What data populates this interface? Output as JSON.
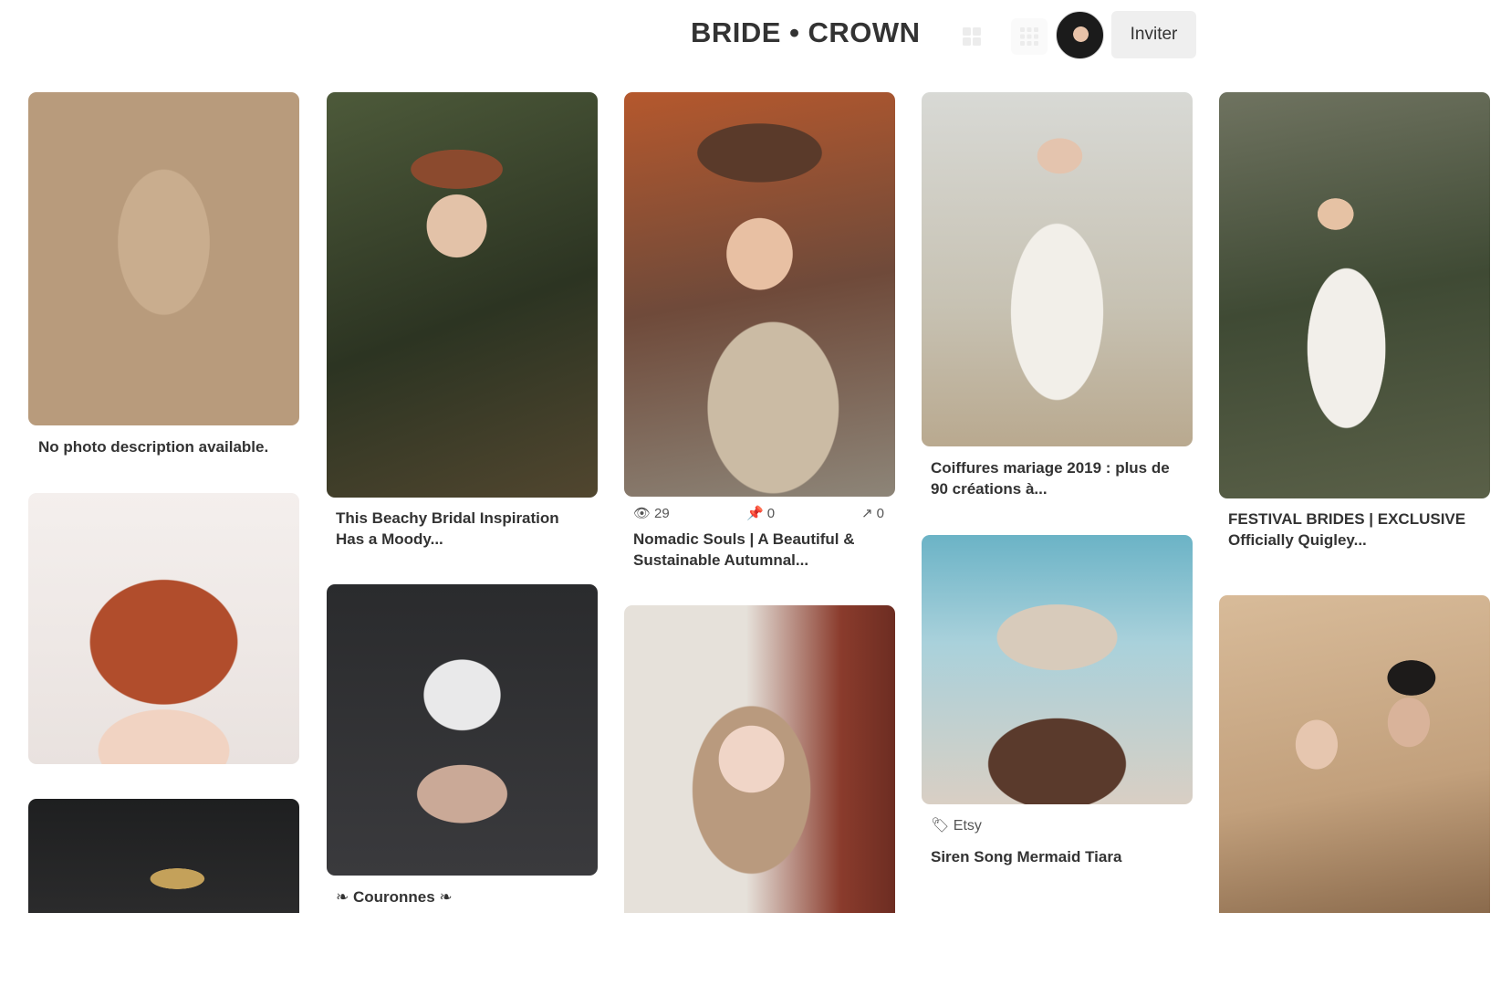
{
  "header": {
    "board_title": "BRIDE • CROWN",
    "invite_label": "Inviter",
    "view_icons": [
      "grid-view-icon",
      "compact-grid-view-icon"
    ]
  },
  "pins": [
    {
      "id": "hat",
      "image": "Bohemian bridal hat with dried flowers",
      "title": "No photo description available."
    },
    {
      "id": "beachy",
      "image": "Red-haired bride with flower crown and bouquet",
      "title": "This Beachy Bridal Inspiration Has a Moody..."
    },
    {
      "id": "nomadic",
      "image": "Red-haired woman in autumnal floral crown",
      "title": "Nomadic Souls | A Beautiful & Sustainable Autumnal...",
      "stats": {
        "views": "29",
        "saves": "0",
        "shares": "0"
      }
    },
    {
      "id": "coiffure",
      "image": "Bride with long dark hair and gold crown",
      "title": "Coiffures mariage 2019 : plus de 90 créations à..."
    },
    {
      "id": "festival",
      "image": "Bride in white dress with shell crown",
      "title": "FESTIVAL BRIDES | EXCLUSIVE Officially Quigley..."
    },
    {
      "id": "redhair",
      "image": "Crystal crown on red hair",
      "title": ""
    },
    {
      "id": "crystal",
      "image": "Hands holding crystal crown",
      "title": "❧ Couronnes ❧"
    },
    {
      "id": "blonde",
      "image": "Blonde woman with gold crown and flowers",
      "title": ""
    },
    {
      "id": "mermaid",
      "image": "Shell mermaid tiara",
      "source": "Etsy",
      "title": "Siren Song Mermaid Tiara"
    },
    {
      "id": "couple",
      "image": "Couple with floral hair pins",
      "title": ""
    },
    {
      "id": "dark",
      "image": "Golden crown on dark background",
      "title": ""
    }
  ]
}
